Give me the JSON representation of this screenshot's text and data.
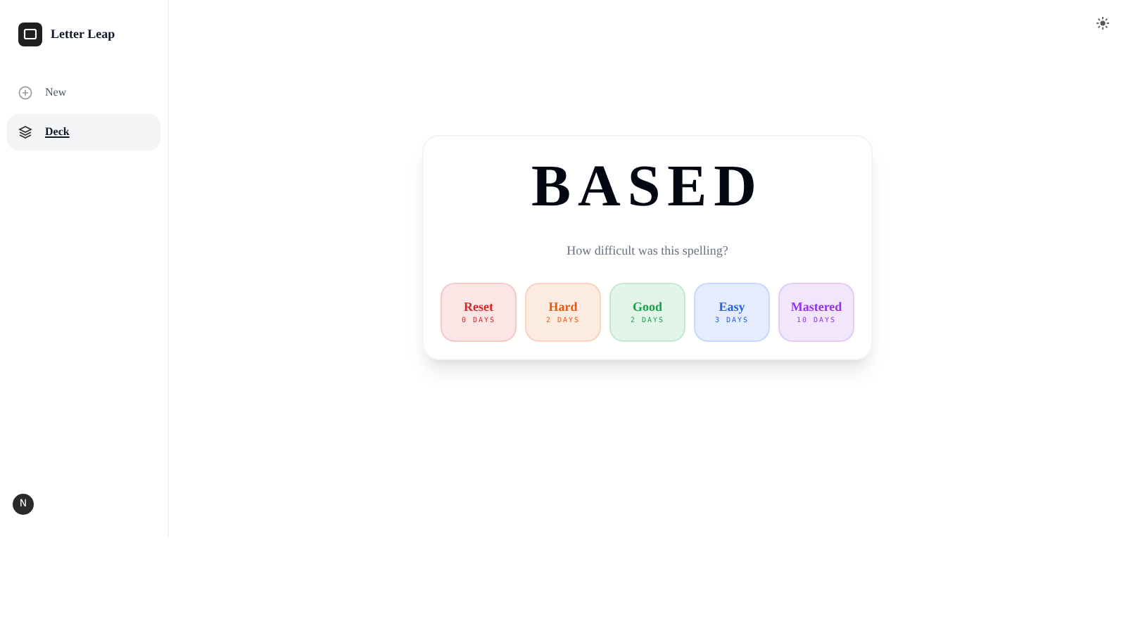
{
  "app": {
    "title": "Letter Leap"
  },
  "nav": [
    {
      "label": "New",
      "selected": false,
      "kind": "new"
    },
    {
      "label": "Deck",
      "selected": true,
      "kind": "deck"
    }
  ],
  "user": {
    "initial": "N"
  },
  "card": {
    "word": "BASED",
    "prompt": "How difficult was this spelling?",
    "ratings": [
      {
        "label": "Reset",
        "interval": "0 DAYS",
        "color": "#dc2626"
      },
      {
        "label": "Hard",
        "interval": "2 DAYS",
        "color": "#ea580c"
      },
      {
        "label": "Good",
        "interval": "2 DAYS",
        "color": "#16a34a"
      },
      {
        "label": "Easy",
        "interval": "3 DAYS",
        "color": "#2563eb"
      },
      {
        "label": "Mastered",
        "interval": "10 DAYS",
        "color": "#9333ea"
      }
    ]
  }
}
